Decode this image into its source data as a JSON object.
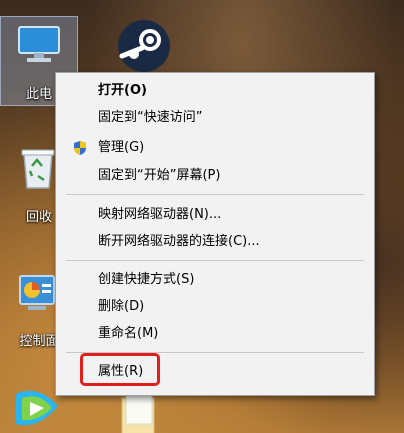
{
  "desktop": {
    "icons": [
      {
        "label": "此电",
        "name": "this-pc"
      },
      {
        "label": "回收",
        "name": "recycle-bin"
      },
      {
        "label": "控制面",
        "name": "control-panel"
      },
      {
        "name": "steam"
      },
      {
        "name": "tencent-video"
      },
      {
        "name": "folder"
      }
    ]
  },
  "context_menu": {
    "items": [
      {
        "label": "打开(O)",
        "bold": true
      },
      {
        "label": "固定到“快速访问”"
      },
      {
        "label": "管理(G)",
        "icon": "uac-shield-icon"
      },
      {
        "label": "固定到“开始”屏幕(P)"
      },
      {
        "label": "映射网络驱动器(N)..."
      },
      {
        "label": "断开网络驱动器的连接(C)..."
      },
      {
        "label": "创建快捷方式(S)"
      },
      {
        "label": "删除(D)"
      },
      {
        "label": "重命名(M)"
      },
      {
        "label": "属性(R)",
        "highlighted": true
      }
    ]
  },
  "colors": {
    "highlight_border": "#e0201c",
    "menu_background": "#f2f2f2"
  }
}
